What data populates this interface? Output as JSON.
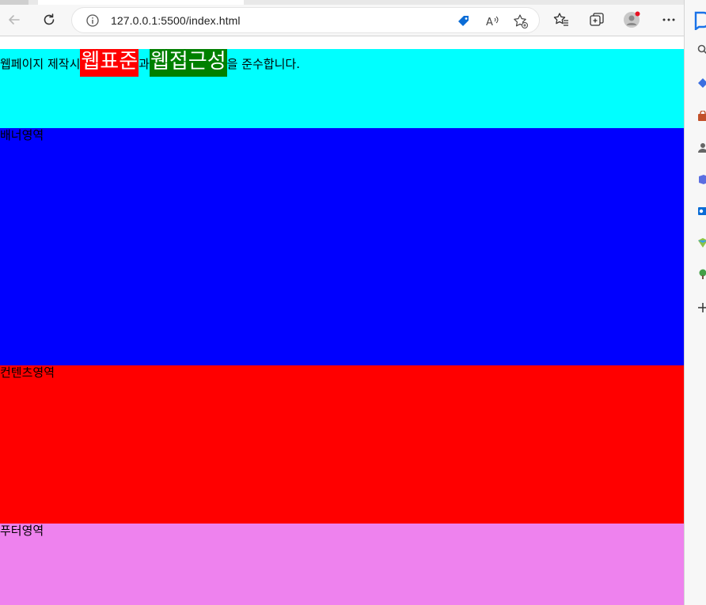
{
  "browser": {
    "url": "127.0.0.1:5500/index.html"
  },
  "page": {
    "header": {
      "text_before": "웹페이지 제작시 ",
      "highlight1": "웹표준",
      "text_middle": "과 ",
      "highlight2": "웹접근성",
      "text_after": "을 준수합니다.",
      "bg_color": "#00ffff",
      "highlight1_color": "#ff0000",
      "highlight2_color": "#008000"
    },
    "banner": {
      "label": "배너영역",
      "bg_color": "#0000ff"
    },
    "content": {
      "label": "컨텐츠영역",
      "bg_color": "#ff0000"
    },
    "footer": {
      "label": "푸터영역",
      "bg_color": "#ee82ee"
    }
  }
}
